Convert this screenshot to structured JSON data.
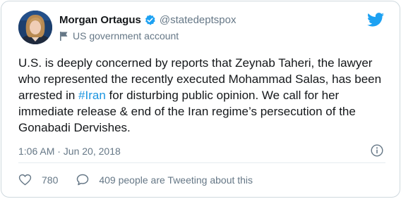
{
  "header": {
    "name": "Morgan Ortagus",
    "handle": "@statedeptspox",
    "account_label": "US government account"
  },
  "tweet": {
    "text_before": "U.S. is deeply concerned by reports that Zeynab Taheri, the lawyer who represented the recently executed Mohammad Salas, has been arrested in ",
    "hashtag": "#Iran",
    "text_after": " for disturbing public opinion. We call for her immediate release & end of the Iran regime’s persecution of the Gonabadi Dervishes.",
    "timestamp": "1:06 AM · Jun 20, 2018"
  },
  "stats": {
    "likes": "780",
    "conversation": "409 people are Tweeting about this"
  },
  "icons": {
    "verified": "verified-badge-icon",
    "flag": "flag-icon",
    "brand": "twitter-bird-icon",
    "info": "info-icon",
    "like": "heart-icon",
    "reply": "speech-bubble-icon"
  },
  "colors": {
    "accent": "#1da1f2",
    "hashtag": "#1b95e0",
    "text": "#14171a",
    "secondary": "#657786"
  }
}
